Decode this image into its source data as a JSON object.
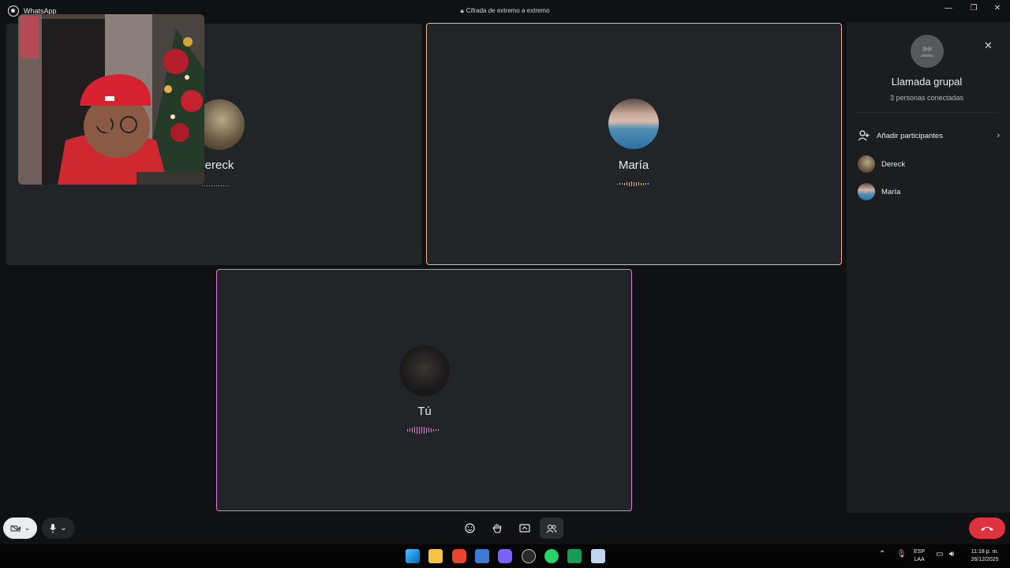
{
  "window": {
    "app_name": "WhatsApp",
    "encryption_label": "Cifrada de extremo a extremo",
    "minimize": "—",
    "restore": "❐",
    "close": "✕"
  },
  "tiles": [
    {
      "name": "Dereck",
      "visible_name": "ereck"
    },
    {
      "name": "María"
    },
    {
      "name": "Tú"
    }
  ],
  "panel": {
    "close": "✕",
    "title": "Llamada grupal",
    "subtitle": "3 personas conectadas",
    "add_label": "Añadir participantes",
    "participants": [
      "Dereck",
      "María"
    ]
  },
  "controls": {
    "emoji_icon": "emoji-icon",
    "raise_hand_icon": "raise-hand-icon",
    "share_screen_icon": "share-screen-icon",
    "participants_icon": "participants-icon",
    "end_call_icon": "end-call-icon"
  },
  "taskbar": {
    "language": "ESP",
    "layout": "LAA",
    "time": "11:18 p. m.",
    "date": "26/12/2025"
  },
  "colors": {
    "active_speaker_border": "#f3b48f",
    "self_border": "#e27fd6",
    "end_call": "#e0323e"
  }
}
